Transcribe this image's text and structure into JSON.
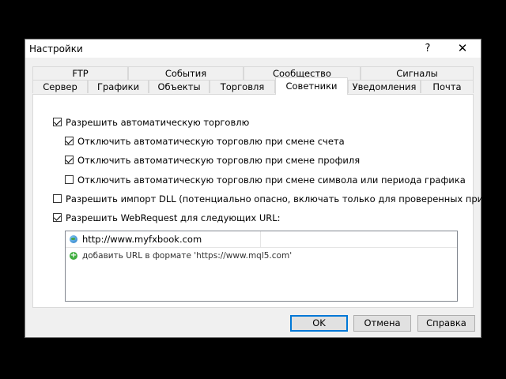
{
  "window": {
    "title": "Настройки",
    "help_label": "?",
    "close_label": "✕"
  },
  "tabs_row1": [
    "FTP",
    "События",
    "Сообщество",
    "Сигналы"
  ],
  "tabs_row2": [
    "Сервер",
    "Графики",
    "Объекты",
    "Торговля",
    "Советники",
    "Уведомления",
    "Почта"
  ],
  "active_tab": "Советники",
  "options": {
    "auto_trading": {
      "label": "Разрешить автоматическую торговлю",
      "checked": true
    },
    "disable_on_account": {
      "label": "Отключить автоматическую торговлю при смене счета",
      "checked": true
    },
    "disable_on_profile": {
      "label": "Отключить автоматическую торговлю при смене профиля",
      "checked": true
    },
    "disable_on_symbol": {
      "label": "Отключить автоматическую торговлю при смене символа или периода графика",
      "checked": false
    },
    "allow_dll": {
      "label": "Разрешить импорт DLL (потенциально опасно, включать только для проверенных приложений)",
      "checked": false
    },
    "allow_webrequest": {
      "label": "Разрешить WebRequest для следующих URL:",
      "checked": true
    }
  },
  "url_list": {
    "urls": [
      "http://www.myfxbook.com"
    ],
    "add_hint": "добавить URL в формате 'https://www.mql5.com'"
  },
  "buttons": {
    "ok": "OK",
    "cancel": "Отмена",
    "help": "Справка"
  },
  "icons": {
    "url_icon": "globe-icon",
    "add_icon": "add-icon"
  },
  "colors": {
    "default_button_border": "#0078d7",
    "add_icon": "#3fae3f"
  }
}
